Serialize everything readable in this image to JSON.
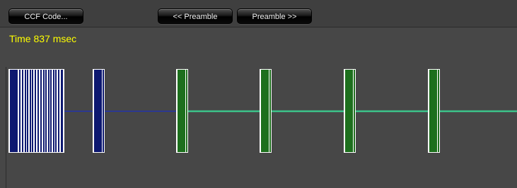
{
  "toolbar": {
    "ccf_code_label": "CCF Code...",
    "prev_preamble_label": "<< Preamble",
    "next_preamble_label": "Preamble >>"
  },
  "timeline": {
    "time_label": "Time 837 msec"
  },
  "colors": {
    "background": "#474747",
    "time_text": "#ffff00",
    "preamble_fill": "#0d1870",
    "repeat_fill": "#1d6f1d",
    "preamble_line": "#2233aa",
    "repeat_line": "#3cc48a",
    "pulse_outline": "#ffffff"
  }
}
